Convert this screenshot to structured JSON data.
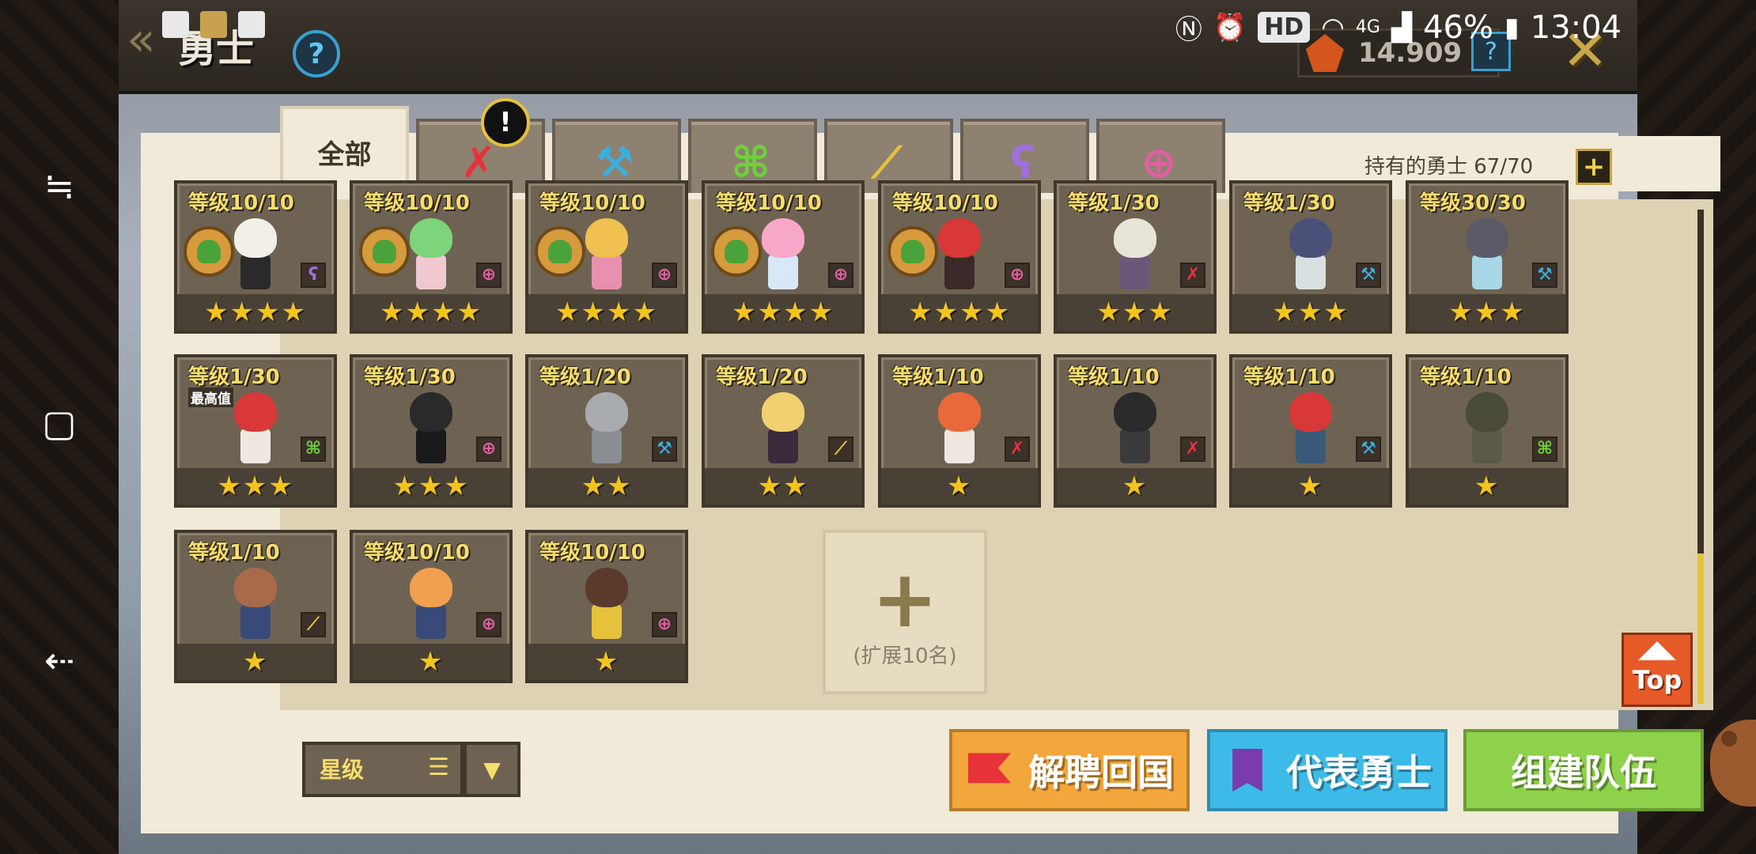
{
  "status_bar": {
    "time": "13:04",
    "battery": "46%",
    "network": "4G",
    "hd_label": "HD"
  },
  "header": {
    "title": "勇士",
    "help_label": "?",
    "gem_count": "14.909",
    "gem_help_label": "?",
    "close_label": "✕"
  },
  "tabs": [
    {
      "label": "全部",
      "icon": "",
      "color": "#3d362c",
      "active": true
    },
    {
      "label": "",
      "icon": "sword-icon",
      "color": "#e8323a",
      "glyph": "✗"
    },
    {
      "label": "",
      "icon": "axe-icon",
      "color": "#3ab0e0",
      "glyph": "⚒"
    },
    {
      "label": "",
      "icon": "bow-icon",
      "color": "#6ed13a",
      "glyph": "⌘"
    },
    {
      "label": "",
      "icon": "gun-icon",
      "color": "#e6c13c",
      "glyph": "⟋"
    },
    {
      "label": "",
      "icon": "staff-icon",
      "color": "#a070e0",
      "glyph": "ʕ"
    },
    {
      "label": "",
      "icon": "orb-icon",
      "color": "#e060a0",
      "glyph": "⊕"
    }
  ],
  "alert_badge": "!",
  "owned": {
    "text": "持有的勇士 67/70",
    "plus": "+"
  },
  "cards": [
    {
      "level": "等级10/10",
      "stars": "★★★★",
      "class_glyph": "ʕ",
      "class_color": "#a070e0",
      "emblem": true,
      "head": "#f1efe8",
      "body": "#2a2a2a"
    },
    {
      "level": "等级10/10",
      "stars": "★★★★",
      "class_glyph": "⊕",
      "class_color": "#e060a0",
      "emblem": true,
      "head": "#7ed47a",
      "body": "#f0c8d0"
    },
    {
      "level": "等级10/10",
      "stars": "★★★★",
      "class_glyph": "⊕",
      "class_color": "#e060a0",
      "emblem": true,
      "head": "#f0c050",
      "body": "#e890b0"
    },
    {
      "level": "等级10/10",
      "stars": "★★★★",
      "class_glyph": "⊕",
      "class_color": "#e060a0",
      "emblem": true,
      "head": "#f7a8c8",
      "body": "#d8e8f8"
    },
    {
      "level": "等级10/10",
      "stars": "★★★★",
      "class_glyph": "⊕",
      "class_color": "#e060a0",
      "emblem": true,
      "head": "#d83838",
      "body": "#3a2a2a"
    },
    {
      "level": "等级1/30",
      "stars": "★★★",
      "class_glyph": "✗",
      "class_color": "#e8323a",
      "emblem": false,
      "head": "#e8e4d8",
      "body": "#6a5878"
    },
    {
      "level": "等级1/30",
      "stars": "★★★",
      "class_glyph": "⚒",
      "class_color": "#3ab0e0",
      "emblem": false,
      "head": "#4a5078",
      "body": "#d8e0e0"
    },
    {
      "level": "等级30/30",
      "stars": "★★★",
      "class_glyph": "⚒",
      "class_color": "#3ab0e0",
      "emblem": false,
      "head": "#5a5a66",
      "body": "#a8d8e8"
    },
    {
      "level": "等级1/30",
      "stars": "★★★",
      "class_glyph": "⌘",
      "class_color": "#6ed13a",
      "emblem": false,
      "head": "#d83838",
      "body": "#f0e8e0",
      "max_tag": "最高值"
    },
    {
      "level": "等级1/30",
      "stars": "★★★",
      "class_glyph": "⊕",
      "class_color": "#e060a0",
      "emblem": false,
      "head": "#2a2a2a",
      "body": "#1a1a1a"
    },
    {
      "level": "等级1/20",
      "stars": "★★",
      "class_glyph": "⚒",
      "class_color": "#3ab0e0",
      "emblem": false,
      "head": "#a8acb0",
      "body": "#8a8e92"
    },
    {
      "level": "等级1/20",
      "stars": "★★",
      "class_glyph": "⟋",
      "class_color": "#e6c13c",
      "emblem": false,
      "head": "#f0d070",
      "body": "#3a2a3a"
    },
    {
      "level": "等级1/10",
      "stars": "★",
      "class_glyph": "✗",
      "class_color": "#e8323a",
      "emblem": false,
      "head": "#e86a3a",
      "body": "#f0e8e0"
    },
    {
      "level": "等级1/10",
      "stars": "★",
      "class_glyph": "✗",
      "class_color": "#e8323a",
      "emblem": false,
      "head": "#2a2a2a",
      "body": "#3a3a3a"
    },
    {
      "level": "等级1/10",
      "stars": "★",
      "class_glyph": "⚒",
      "class_color": "#3ab0e0",
      "emblem": false,
      "head": "#d83838",
      "body": "#3a5878"
    },
    {
      "level": "等级1/10",
      "stars": "★",
      "class_glyph": "⌘",
      "class_color": "#6ed13a",
      "emblem": false,
      "head": "#4a4a3a",
      "body": "#5a5a4a"
    },
    {
      "level": "等级1/10",
      "stars": "★",
      "class_glyph": "⟋",
      "class_color": "#e6c13c",
      "emblem": false,
      "head": "#a86a4a",
      "body": "#3a4a78"
    },
    {
      "level": "等级10/10",
      "stars": "★",
      "class_glyph": "⊕",
      "class_color": "#e060a0",
      "emblem": false,
      "head": "#f0a050",
      "body": "#3a4a78"
    },
    {
      "level": "等级10/10",
      "stars": "★",
      "class_glyph": "⊕",
      "class_color": "#e060a0",
      "emblem": false,
      "head": "#5a3a2a",
      "body": "#e6c13c"
    }
  ],
  "expand": {
    "plus": "+",
    "label": "(扩展10名)"
  },
  "top_button": "Top",
  "sort": {
    "label": "星级",
    "dropdown": "▼"
  },
  "buttons": {
    "dismiss": "解聘回国",
    "leader": "代表勇士",
    "team": "组建队伍"
  }
}
